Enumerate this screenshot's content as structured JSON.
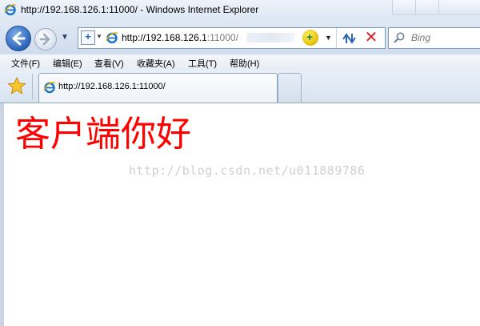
{
  "window": {
    "title": "http://192.168.126.1:11000/ - Windows Internet Explorer"
  },
  "navigation": {
    "address_host": "http://192.168.126.1",
    "address_port": ":11000/",
    "search_placeholder": "Bing"
  },
  "menu": {
    "items": [
      "文件(F)",
      "编辑(E)",
      "查看(V)",
      "收藏夹(A)",
      "工具(T)",
      "帮助(H)"
    ]
  },
  "tabs": {
    "active_title": "http://192.168.126.1:11000/"
  },
  "content": {
    "greeting": "客户端你好",
    "watermark": "http://blog.csdn.net/u011889786"
  },
  "colors": {
    "greeting": "#ff0000",
    "accent": "#2b63b8"
  }
}
